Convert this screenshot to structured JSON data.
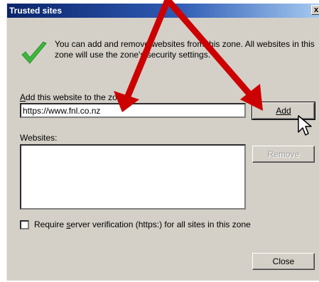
{
  "window": {
    "title": "Trusted sites",
    "close_glyph": "x"
  },
  "info": {
    "text": "You can add and remove websites from this zone. All websites in this zone will use the zone's security settings.",
    "icon": "checkmark-icon"
  },
  "add_site": {
    "label_prefix": "A",
    "label_rest": "dd this website to the zone:",
    "value": "https://www.fnl.co.nz",
    "add_button": "Add"
  },
  "websites": {
    "label": "Websites:",
    "items": [],
    "remove_button": "Remove"
  },
  "require_verification": {
    "checked": false,
    "label_pre": "Require ",
    "label_u": "s",
    "label_post": "erver verification (https:) for all sites in this zone"
  },
  "close_button": "Close",
  "colors": {
    "titlebar_start": "#0a246a",
    "titlebar_end": "#a6caf0",
    "dialog_bg": "#d4d0c8",
    "annotation_arrow": "#cc0000",
    "check_green": "#3cb93c"
  }
}
